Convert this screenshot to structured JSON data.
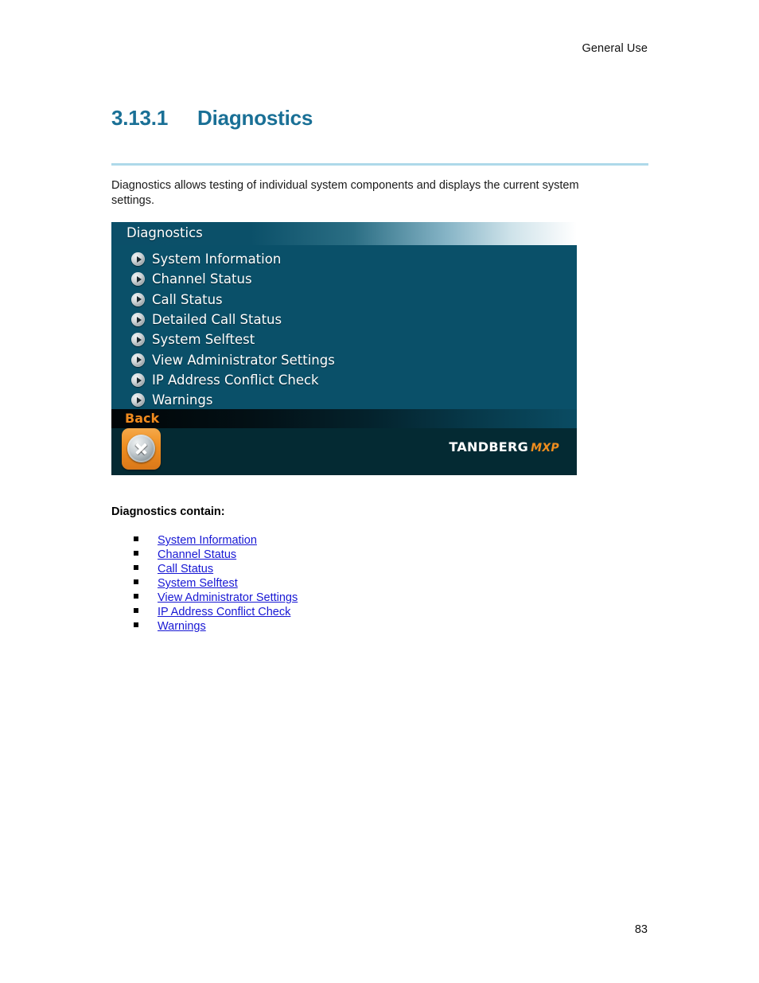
{
  "document": {
    "running_header": "General Use",
    "page_number": "83",
    "heading_number": "3.13.1",
    "heading_title": "Diagnostics",
    "intro_paragraph": "Diagnostics allows testing of individual system components and displays the current system settings.",
    "contains_title": "Diagnostics contain:",
    "links": [
      "System Information",
      "Channel Status",
      "Call Status",
      "System Selftest",
      "View Administrator Settings",
      "IP Address Conflict Check",
      "Warnings"
    ]
  },
  "ui_screenshot": {
    "title": "Diagnostics",
    "menu_items": [
      {
        "label": "System Information",
        "icon": "play-arrow-icon"
      },
      {
        "label": "Channel Status",
        "icon": "play-arrow-icon"
      },
      {
        "label": "Call Status",
        "icon": "play-arrow-icon"
      },
      {
        "label": "Detailed Call Status",
        "icon": "play-arrow-icon"
      },
      {
        "label": "System Selftest",
        "icon": "play-arrow-icon"
      },
      {
        "label": "View Administrator Settings",
        "icon": "play-arrow-icon"
      },
      {
        "label": "IP Address Conflict Check",
        "icon": "play-arrow-icon"
      },
      {
        "label": "Warnings",
        "icon": "play-arrow-icon"
      }
    ],
    "back_label": "Back",
    "close_button_icon": "close-x-icon",
    "logo_brand": "TANDBERG",
    "logo_sub": "MXP"
  },
  "colors": {
    "heading_teal": "#1a7096",
    "rule_light_blue": "#aed9ea",
    "ui_menu_bg": "#0a5069",
    "ui_footer_bg": "#042a33",
    "accent_orange": "#ef8d1e",
    "link_blue": "#1818d4"
  }
}
